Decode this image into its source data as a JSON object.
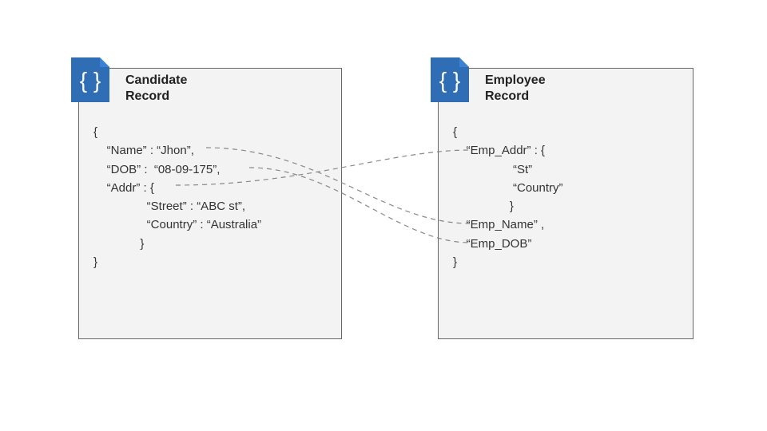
{
  "left": {
    "title": "Candidate\nRecord",
    "code": "{\n    “Name” : “Jhon”,\n    “DOB” :  “08-09-175”,\n    “Addr” : {\n                “Street” : “ABC st”,\n                “Country” : “Australia”\n              }\n}"
  },
  "right": {
    "title": "Employee\nRecord",
    "code": "{\n    “Emp_Addr” : {\n                  “St”\n                  “Country”\n                 }\n    “Emp_Name” ,\n    “Emp_DOB”\n}"
  },
  "icon_label": "{ }",
  "mappings": [
    {
      "from": "Name",
      "to": "Emp_Name"
    },
    {
      "from": "DOB",
      "to": "Emp_DOB"
    },
    {
      "from": "Addr",
      "to": "Emp_Addr"
    }
  ]
}
